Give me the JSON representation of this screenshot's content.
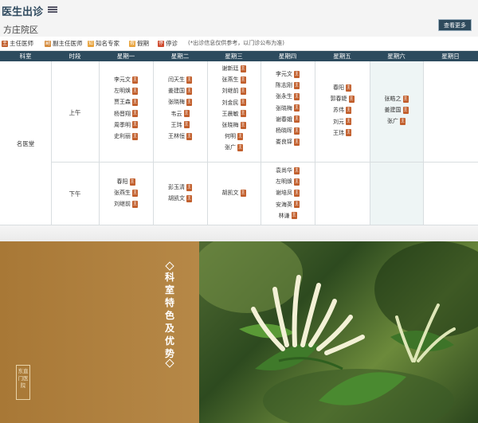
{
  "header": {
    "title": "医生出诊",
    "campus": "方庄院区",
    "more_button": "查看更多"
  },
  "legend": {
    "items": [
      {
        "icon": "主",
        "label": "主任医师",
        "color": "#c2602e"
      },
      {
        "icon": "副",
        "label": "副主任医师",
        "color": "#d58a3a"
      },
      {
        "icon": "知",
        "label": "知名专家",
        "color": "#e8a23a"
      },
      {
        "icon": "假",
        "label": "假期",
        "color": "#e8a23a"
      },
      {
        "icon": "停",
        "label": "停诊",
        "color": "#cf4a2e"
      }
    ],
    "note": "(*出诊信息仅供参考，以门诊公布为准)"
  },
  "table": {
    "headers": [
      "科室",
      "时段",
      "星期一",
      "星期二",
      "星期三",
      "星期四",
      "星期五",
      "星期六",
      "星期日"
    ],
    "department": "名医堂",
    "morning_label": "上午",
    "afternoon_label": "下午",
    "badge": "主",
    "morning": {
      "mon": [
        "李元文",
        "左明焕",
        "贾王森",
        "杨晋翔",
        "周季明",
        "史利丽"
      ],
      "tue": [
        "闫天生",
        "姜建国",
        "张晓梅",
        "韦云",
        "王玮",
        "王林恒"
      ],
      "wed": [
        "谢新廷",
        "张燕生",
        "刘继前",
        "刘金民",
        "王晨敏",
        "张晓梅",
        "何明",
        "张广"
      ],
      "thu": [
        "李元文",
        "陈志刚",
        "张永生",
        "张晓梅",
        "谢春娥",
        "杨晓晖",
        "娄良铎"
      ],
      "fri": [
        "春阳",
        "郭春婕",
        "苏伟",
        "刘元",
        "王玮"
      ],
      "sat": [
        "张皓之",
        "姜建国",
        "张广"
      ],
      "sun": []
    },
    "afternoon": {
      "mon": [
        "春阳",
        "张燕生",
        "刘继前"
      ],
      "tue": [
        "彭玉清",
        "胡凯文"
      ],
      "wed": [
        "胡凯文"
      ],
      "thu": [
        "袁尚华",
        "左明焕",
        "谢培凤",
        "安海英",
        "林谦"
      ],
      "fri": [],
      "sat": [],
      "sun": []
    }
  },
  "feature": {
    "title": "科室特色及优势",
    "seal_text": "东直门医院"
  }
}
